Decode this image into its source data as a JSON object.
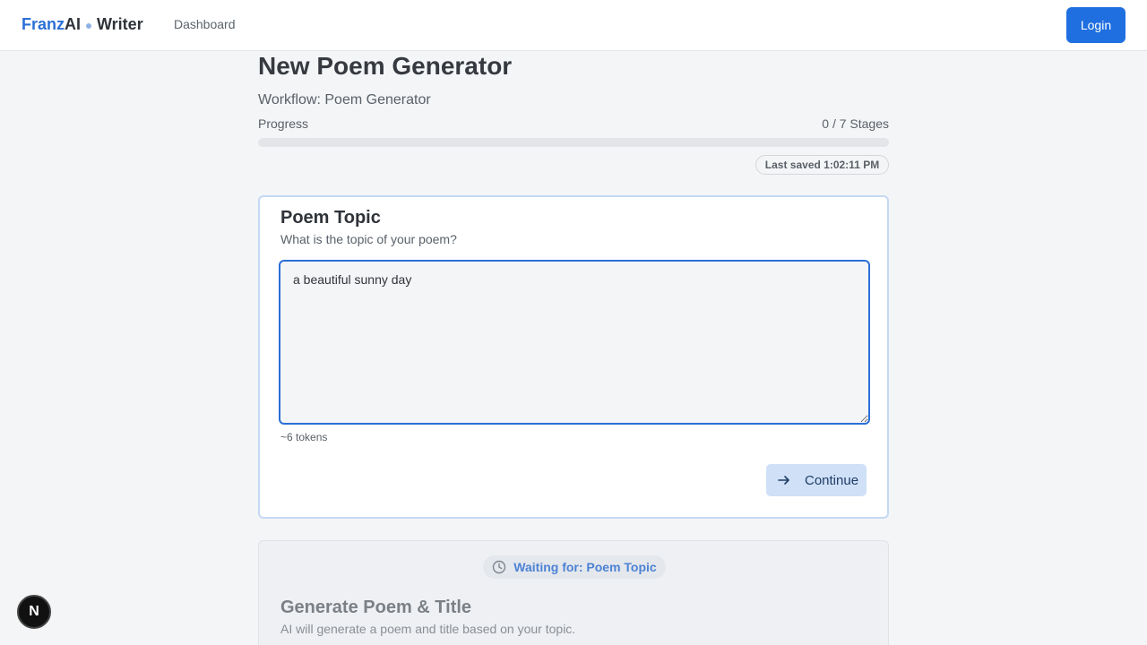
{
  "header": {
    "brand_franz": "Franz",
    "brand_ai": "AI",
    "brand_writer": "Writer",
    "nav_dashboard": "Dashboard",
    "login_label": "Login"
  },
  "page": {
    "title": "New Poem Generator",
    "workflow": "Workflow: Poem Generator",
    "progress_label": "Progress",
    "progress_count": "0 / 7 Stages",
    "progress_fraction": 0,
    "last_saved": "Last saved 1:02:11 PM"
  },
  "active_stage": {
    "title": "Poem Topic",
    "description": "What is the topic of your poem?",
    "input_value": "a beautiful sunny day",
    "tokens": "~6 tokens",
    "continue_label": "Continue"
  },
  "pending_stage": {
    "waiting": "Waiting for: Poem Topic",
    "title": "Generate Poem & Title",
    "description": "AI will generate a poem and title based on your topic."
  },
  "floating_badge": {
    "letter": "N"
  },
  "colors": {
    "accent": "#1f6fe0",
    "active_border": "#c4d9f3",
    "background": "#f4f5f7"
  }
}
